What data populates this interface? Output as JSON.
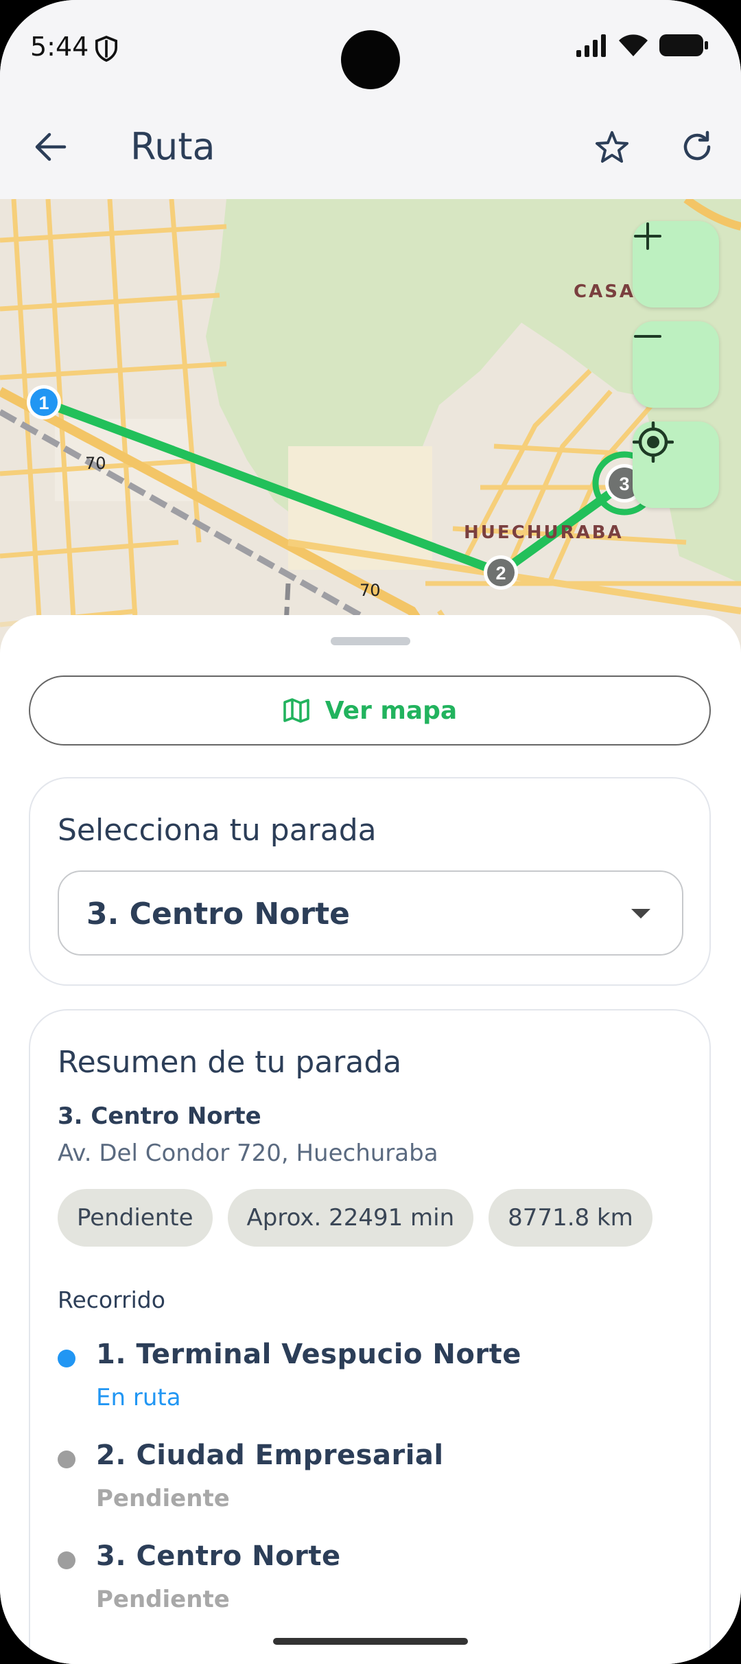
{
  "status_bar": {
    "time": "5:44"
  },
  "app_bar": {
    "title": "Ruta"
  },
  "map": {
    "labels": {
      "casas": "CASAS",
      "huechuraba": "HUECHURABA",
      "road_70_a": "70",
      "road_70_b": "70"
    },
    "markers": [
      "1",
      "2",
      "3"
    ],
    "route_color": "#22c05a"
  },
  "sheet": {
    "view_map_label": "Ver mapa",
    "stop_select": {
      "title": "Selecciona tu parada",
      "selected": "3. Centro Norte"
    },
    "summary": {
      "title": "Resumen de tu parada",
      "stop_name": "3. Centro Norte",
      "address": "Av. Del Condor 720, Huechuraba",
      "chips": [
        "Pendiente",
        "Aprox. 22491 min",
        "8771.8 km"
      ],
      "route_label": "Recorrido",
      "stops": [
        {
          "name": "1. Terminal Vespucio Norte",
          "status": "En ruta",
          "dot_color": "#2196f3",
          "status_color": "#2196f3"
        },
        {
          "name": "2. Ciudad Empresarial",
          "status": "Pendiente",
          "dot_color": "#9e9e9e",
          "status_color": "#a8a8a8"
        },
        {
          "name": "3. Centro Norte",
          "status": "Pendiente",
          "dot_color": "#9e9e9e",
          "status_color": "#a8a8a8"
        }
      ]
    }
  },
  "colors": {
    "accent": "#22b35e",
    "title": "#2c3e58",
    "map_button": "#bdf0c0"
  }
}
